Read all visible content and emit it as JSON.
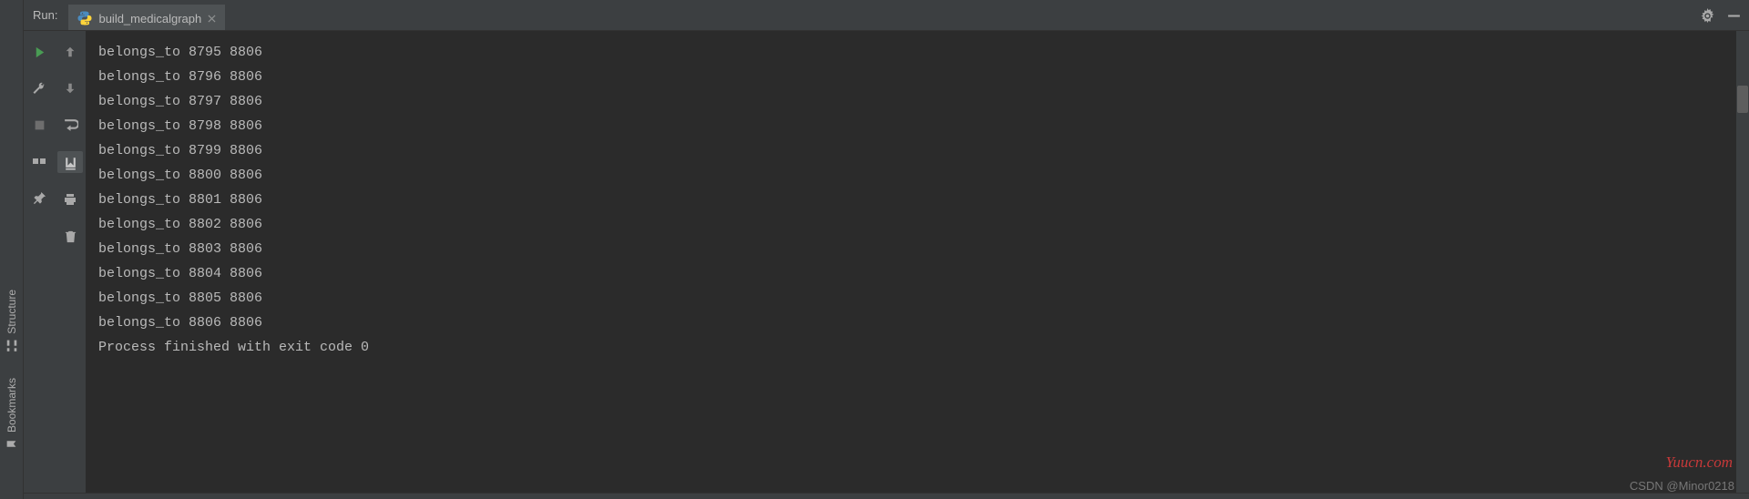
{
  "sidebar": {
    "items": [
      {
        "label": "Structure",
        "icon": "structure-icon"
      },
      {
        "label": "Bookmarks",
        "icon": "bookmark-icon"
      }
    ]
  },
  "tabBar": {
    "run_label": "Run:",
    "tab": {
      "label": "build_medicalgraph",
      "icon": "python-icon"
    }
  },
  "console": {
    "lines": [
      "belongs_to 8795 8806",
      "belongs_to 8796 8806",
      "belongs_to 8797 8806",
      "belongs_to 8798 8806",
      "belongs_to 8799 8806",
      "belongs_to 8800 8806",
      "belongs_to 8801 8806",
      "belongs_to 8802 8806",
      "belongs_to 8803 8806",
      "belongs_to 8804 8806",
      "belongs_to 8805 8806",
      "belongs_to 8806 8806",
      "",
      "Process finished with exit code 0"
    ]
  },
  "watermarks": {
    "red": "Yuucn.com",
    "grey": "CSDN @Minor0218"
  }
}
